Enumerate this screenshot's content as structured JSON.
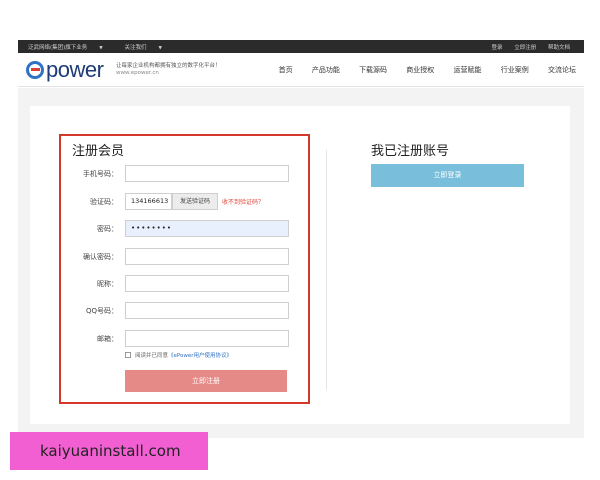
{
  "topbar": {
    "left_items": [
      "泛武网络(集团)旗下业务",
      "关注我们"
    ],
    "right_items": [
      "登录",
      "立即注册",
      "帮助文档"
    ]
  },
  "header": {
    "logo_text": "power",
    "slogan": "让每家企业机构都拥有独立的数字化平台！",
    "site_url": "www.epower.cn",
    "nav": [
      "首页",
      "产品功能",
      "下载源码",
      "商业授权",
      "运营赋能",
      "行业案例",
      "交流论坛"
    ]
  },
  "register": {
    "title": "注册会员",
    "fields": {
      "phone": {
        "label": "手机号码：",
        "value": ""
      },
      "code": {
        "label": "验证码：",
        "value": "134166613"
      },
      "password": {
        "label": "密码：",
        "value": "••••••••"
      },
      "confirm": {
        "label": "确认密码：",
        "value": ""
      },
      "nickname": {
        "label": "昵称：",
        "value": ""
      },
      "qq": {
        "label": "QQ号码：",
        "value": ""
      },
      "email": {
        "label": "邮箱：",
        "value": ""
      }
    },
    "send_code_label": "发送验证码",
    "no_code_link": "收不到验证码？",
    "agree_text": "阅读并已同意",
    "agree_link": "《ePower用户使用协议》",
    "agree_checked": false,
    "submit_label": "立即注册"
  },
  "login": {
    "title": "我已注册账号",
    "button_label": "立即登录"
  },
  "watermark": "kaiyuaninstall.com",
  "colors": {
    "topbar_bg": "#2b2b2b",
    "highlight_border": "#d4382b",
    "register_button": "#e58a86",
    "login_button": "#79bfdc",
    "link": "#2f72c5",
    "watermark_bg": "#f25fd2"
  }
}
